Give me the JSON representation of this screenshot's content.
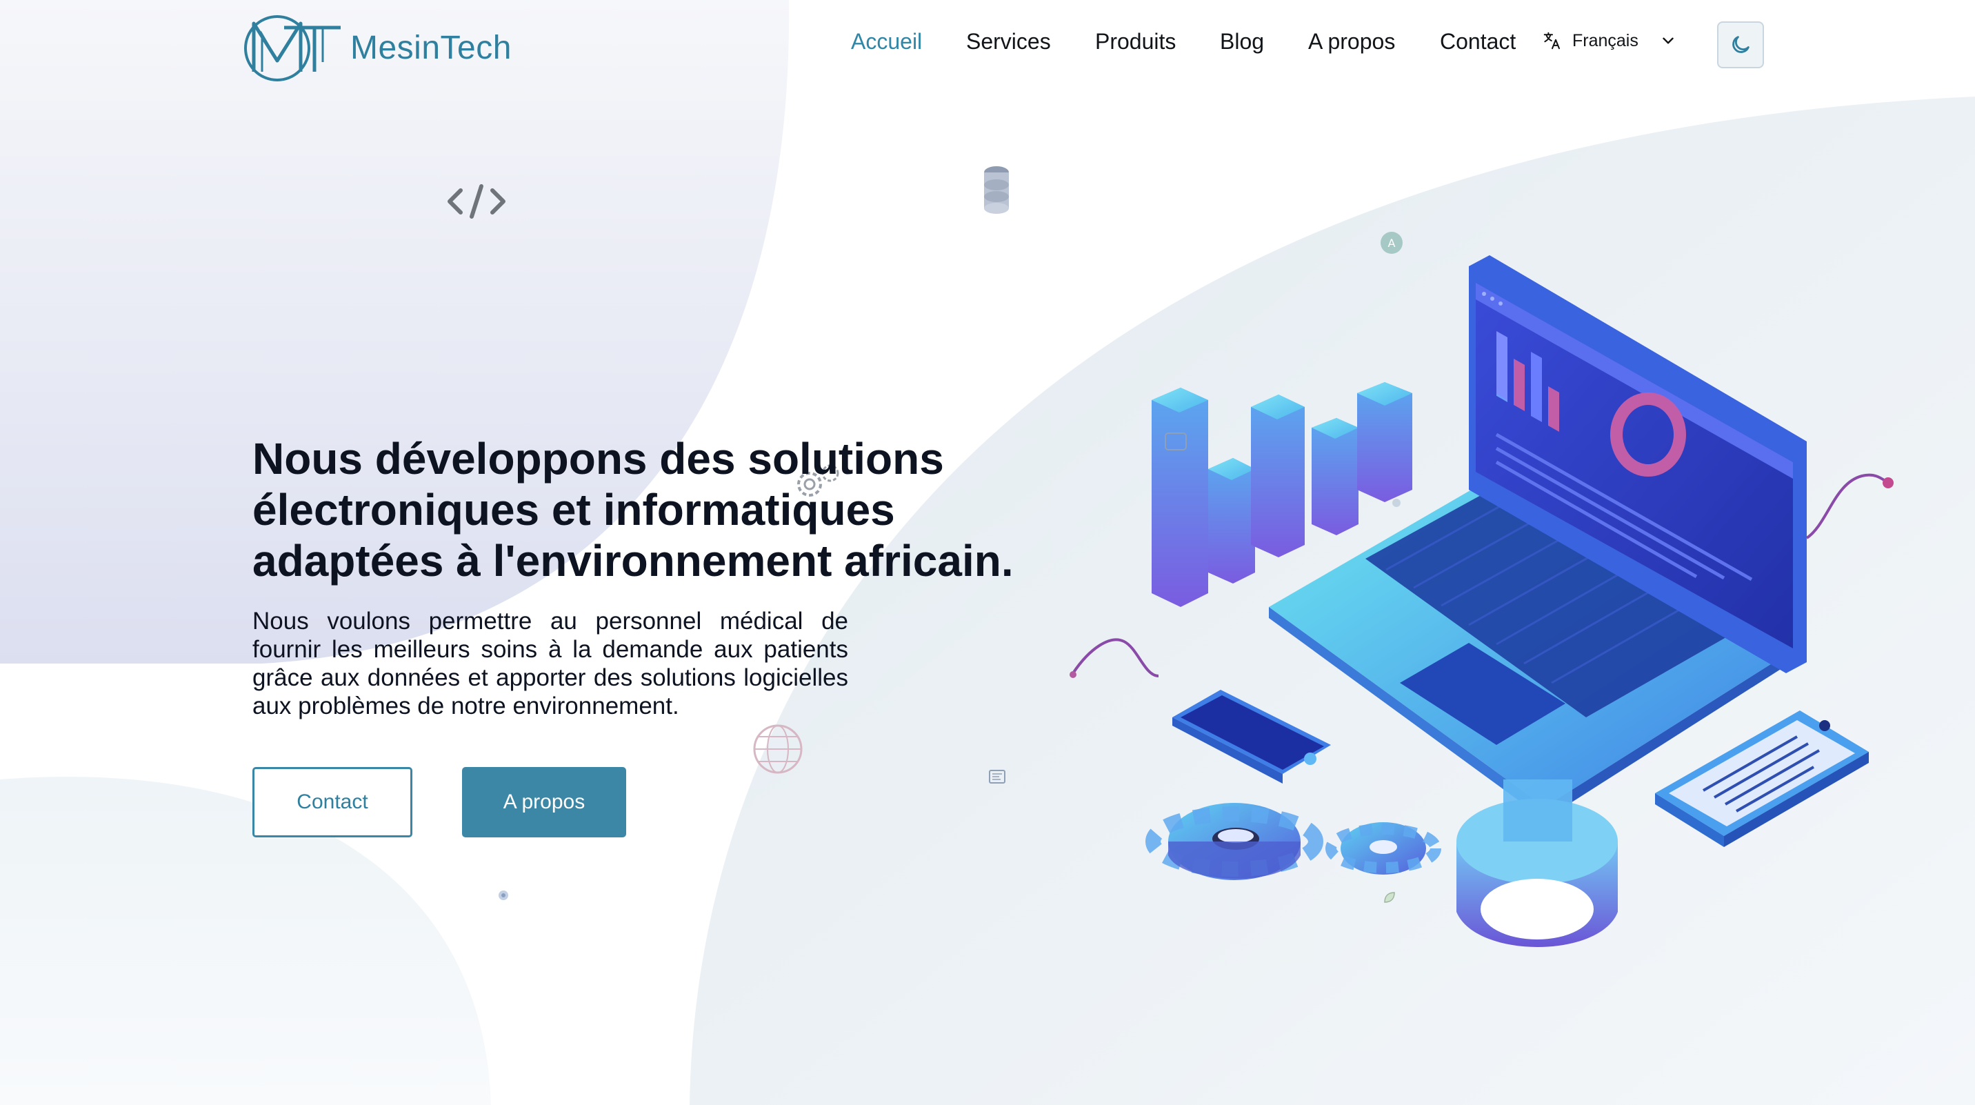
{
  "brand": {
    "name": "MesinTech",
    "color": "#2f7f9e"
  },
  "nav": {
    "items": [
      {
        "label": "Accueil",
        "active": true
      },
      {
        "label": "Services",
        "active": false
      },
      {
        "label": "Produits",
        "active": false
      },
      {
        "label": "Blog",
        "active": false
      },
      {
        "label": "A propos",
        "active": false
      },
      {
        "label": "Contact",
        "active": false
      }
    ],
    "language": {
      "selected": "Français",
      "icon": "translate-icon",
      "chevron": "chevron-down-icon"
    },
    "theme_toggle": {
      "icon": "moon-icon"
    }
  },
  "hero": {
    "title": "Nous développons des solutions électroniques et informatiques adaptées à l'environnement africain.",
    "description": "Nous voulons permettre au personnel médical de fournir les meilleurs soins à la demande aux patients grâce aux données et apporter des solutions logicielles aux problèmes de notre environnement.",
    "buttons": {
      "contact": "Contact",
      "about": "A propos"
    }
  },
  "decorations": [
    "code-icon",
    "database-icon",
    "gear-icon",
    "globe-icon",
    "chip-icon",
    "laptop-illustration"
  ],
  "colors": {
    "accent": "#3d87a6",
    "text": "#0d1320",
    "nav_active": "#2f86a6"
  }
}
